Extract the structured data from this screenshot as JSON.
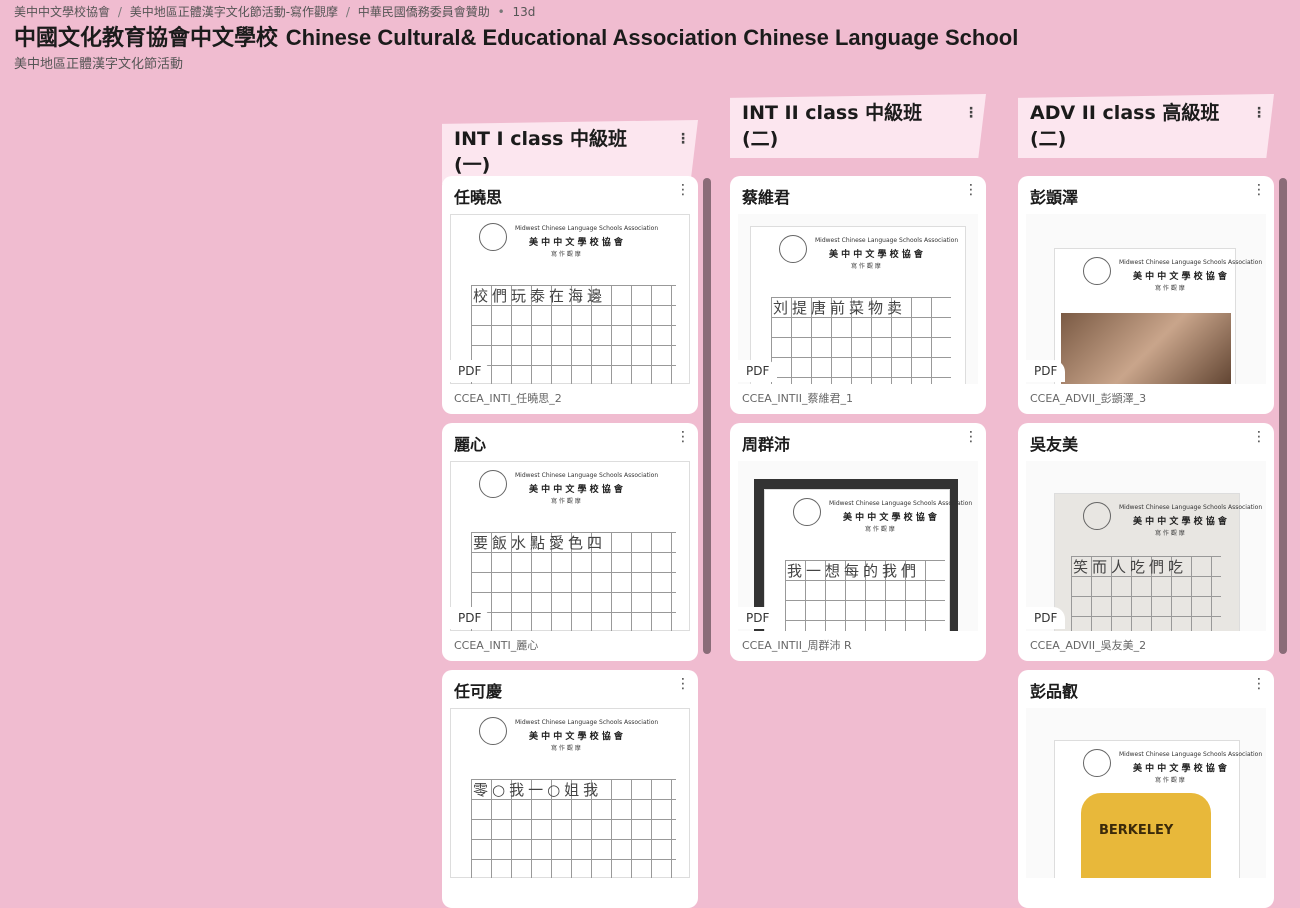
{
  "header": {
    "breadcrumbs": [
      "美中中文學校協會",
      "美中地區正體漢字文化節活動-寫作觀摩",
      "中華民國僑務委員會贊助"
    ],
    "age": "13d",
    "title_zh": "中國文化教育協會中文學校",
    "title_en": "Chinese Cultural& Educational Association Chinese Language School",
    "subtitle": "美中地區正體漢字文化節活動"
  },
  "columns": [
    {
      "title": "INT I class 中級班 (一)",
      "cards": [
        {
          "name": "任曉思",
          "badge": "PDF",
          "file": "CCEA_INTI_任曉思_2",
          "hw": "校們玩泰在海邊"
        },
        {
          "name": "麗心",
          "badge": "PDF",
          "file": "CCEA_INTI_麗心",
          "hw": "要飯水點愛色四"
        },
        {
          "name": "任可慶",
          "badge": "PDF",
          "file": "",
          "hw": "零○我一○姐我"
        }
      ]
    },
    {
      "title": "INT II class 中級班 (二)",
      "cards": [
        {
          "name": "蔡維君",
          "badge": "PDF",
          "file": "CCEA_INTII_蔡維君_1",
          "hw": "刘提唐前菜物卖"
        },
        {
          "name": "周群沛",
          "badge": "PDF",
          "file": "CCEA_INTII_周群沛 R",
          "hw": "我一想每的我們"
        }
      ]
    },
    {
      "title": "ADV II class 高級班 (二)",
      "cards": [
        {
          "name": "彭顗澤",
          "badge": "PDF",
          "file": "CCEA_ADVII_彭顗澤_3",
          "hw": ""
        },
        {
          "name": "吳友美",
          "badge": "PDF",
          "file": "CCEA_ADVII_吳友美_2",
          "hw": "笑而人吃們吃"
        },
        {
          "name": "彭品叡",
          "badge": "PDF",
          "file": "",
          "hw": "",
          "shirt": "BERKELEY"
        }
      ]
    }
  ],
  "sheet": {
    "assoc": "Midwest Chinese Language Schools Association",
    "school": "美 中 中 文 學 校 協 會",
    "sub": "寫 作 觀 摩"
  },
  "icons": {
    "menu": "more-vertical-icon"
  }
}
